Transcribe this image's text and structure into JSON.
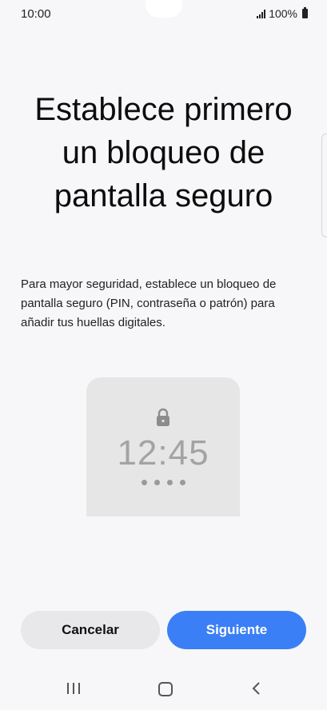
{
  "status_bar": {
    "time": "10:00",
    "battery": "100%"
  },
  "title": "Establece primero un bloqueo de pantalla seguro",
  "description": "Para mayor seguridad, establece un bloqueo de pantalla seguro (PIN, contraseña o patrón) para añadir tus huellas digitales.",
  "illustration": {
    "time": "12:45",
    "icon": "lock-icon",
    "pin_dots": 4
  },
  "buttons": {
    "cancel": "Cancelar",
    "next": "Siguiente"
  },
  "colors": {
    "accent": "#3a7ff5",
    "background": "#f7f7f9",
    "card": "#e6e6e6"
  },
  "nav_bar": {
    "recent_icon": "recent-apps-icon",
    "home_icon": "home-icon",
    "back_icon": "back-icon"
  }
}
